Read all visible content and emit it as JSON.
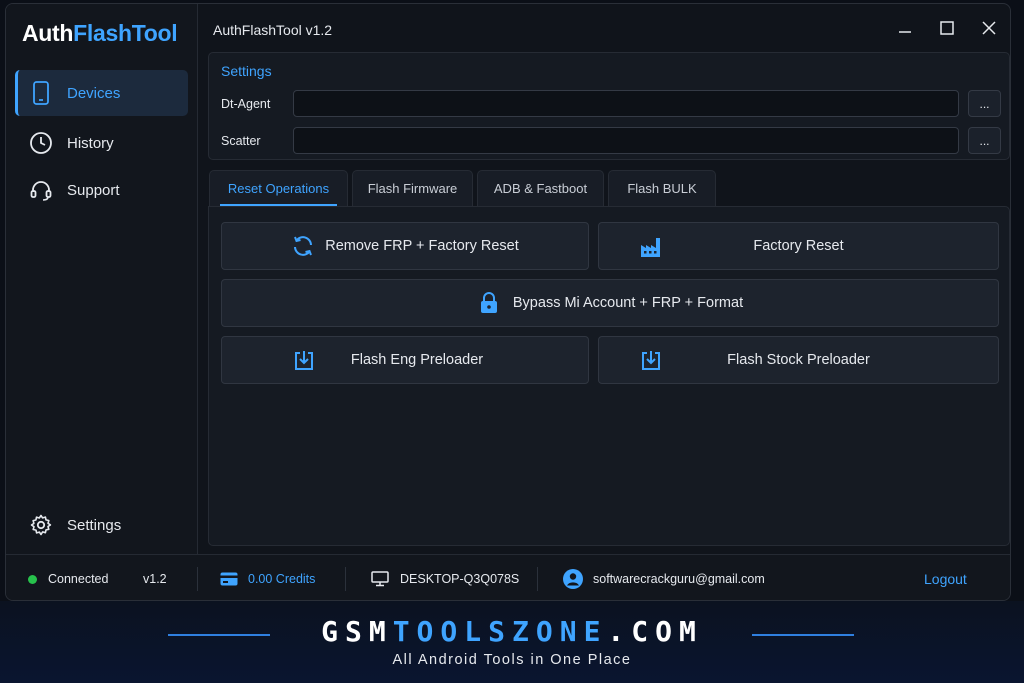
{
  "app": {
    "logo_white": "Auth",
    "logo_blue": "FlashTool",
    "window_title": "AuthFlashTool v1.2"
  },
  "sidebar": {
    "items": [
      {
        "label": "Devices",
        "icon": "phone-icon",
        "active": true
      },
      {
        "label": "History",
        "icon": "clock-icon",
        "active": false
      },
      {
        "label": "Support",
        "icon": "headset-icon",
        "active": false
      }
    ],
    "bottom_item": {
      "label": "Settings",
      "icon": "gear-icon"
    }
  },
  "window_controls": {
    "minimize": "minimize-icon",
    "maximize": "maximize-icon",
    "close": "close-icon"
  },
  "settings": {
    "title": "Settings",
    "rows": [
      {
        "label": "Dt-Agent",
        "value": "",
        "browse": "..."
      },
      {
        "label": "Scatter",
        "value": "",
        "browse": "..."
      }
    ]
  },
  "tabs": [
    {
      "label": "Reset Operations",
      "active": true
    },
    {
      "label": "Flash Firmware",
      "active": false
    },
    {
      "label": "ADB & Fastboot",
      "active": false
    },
    {
      "label": "Flash BULK",
      "active": false
    }
  ],
  "operations": [
    {
      "label": "Remove FRP + Factory Reset",
      "icon": "refresh-icon"
    },
    {
      "label": "Factory Reset",
      "icon": "factory-icon"
    },
    {
      "label": "Bypass Mi Account + FRP + Format",
      "icon": "lock-icon"
    },
    {
      "label": "Flash Eng Preloader",
      "icon": "download-icon"
    },
    {
      "label": "Flash Stock Preloader",
      "icon": "download-icon"
    }
  ],
  "statusbar": {
    "status": "Connected",
    "version": "v1.2",
    "credits": "0.00 Credits",
    "computer": "DESKTOP-Q3Q078S",
    "email": "softwarecrackguru@gmail.com",
    "logout": "Logout"
  },
  "banner": {
    "brand_white_1": "GSM",
    "brand_blue": "TOOLSZONE",
    "brand_white_2": ".COM",
    "tagline": "All Android Tools in One Place"
  },
  "colors": {
    "accent": "#3fa4ff",
    "background": "#10141b",
    "panel": "#151a22",
    "connected": "#27c24c"
  }
}
